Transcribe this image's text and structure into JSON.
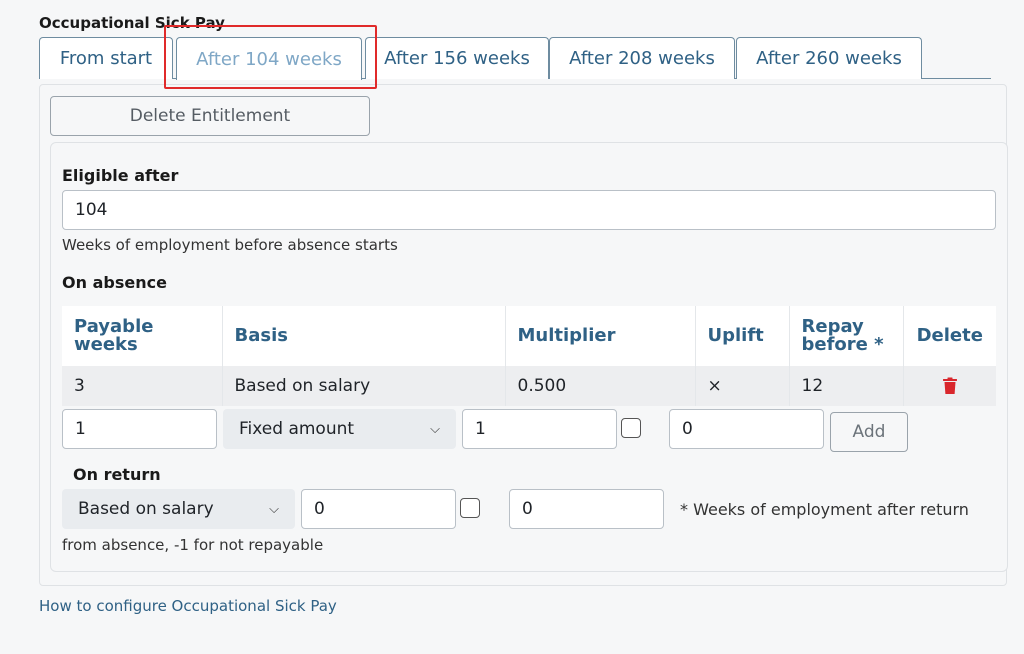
{
  "section_title": "Occupational Sick Pay",
  "tabs": [
    {
      "label": "From start"
    },
    {
      "label": "After 104 weeks"
    },
    {
      "label": "After 156 weeks"
    },
    {
      "label": "After 208 weeks"
    },
    {
      "label": "After 260 weeks"
    }
  ],
  "active_tab": 1,
  "delete_entitlement_label": "Delete Entitlement",
  "eligible_after": {
    "label": "Eligible after",
    "value": "104",
    "help": "Weeks of employment before absence starts"
  },
  "on_absence": {
    "label": "On absence",
    "columns": [
      "Payable weeks",
      "Basis",
      "Multiplier",
      "Uplift",
      "Repay before *",
      "Delete"
    ],
    "rows": [
      {
        "payable_weeks": "3",
        "basis": "Based on salary",
        "multiplier": "0.500",
        "uplift": "×",
        "repay_before": "12"
      }
    ],
    "new_row": {
      "payable_weeks": "1",
      "basis": "Fixed amount",
      "multiplier": "1",
      "repay_before": "0",
      "add_label": "Add"
    }
  },
  "on_return": {
    "label": "On return",
    "basis": "Based on salary",
    "multiplier": "0",
    "repay": "0",
    "note_part1": "* Weeks of employment after return",
    "note_part2": "from absence, -1 for not repayable"
  },
  "help_link": "How to configure Occupational Sick Pay",
  "colors": {
    "accent": "#2f6185",
    "active_tab_text": "#7fa7c6",
    "highlight": "#e02a2a",
    "delete_icon": "#d9262c"
  }
}
